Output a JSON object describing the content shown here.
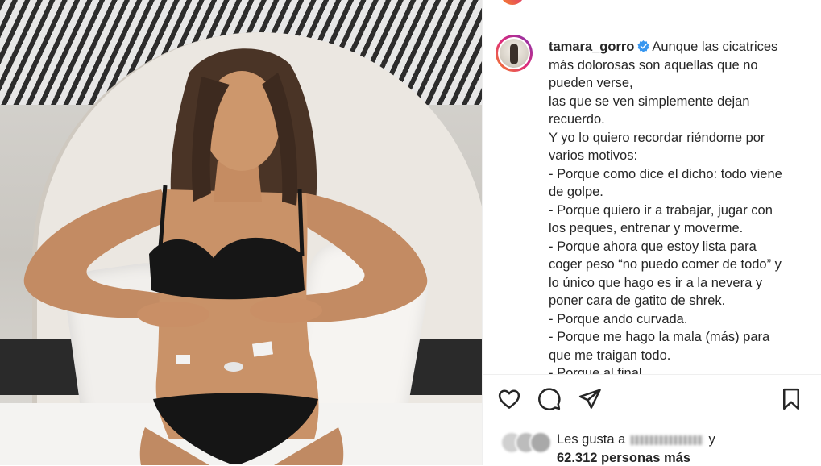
{
  "post": {
    "username": "tamara_gorro",
    "verified": true,
    "caption_lines": [
      "Aunque las cicatrices",
      "más dolorosas son aquellas que no",
      "pueden verse,",
      "las que se ven simplemente dejan",
      "recuerdo.",
      "Y yo lo quiero recordar riéndome por",
      "varios motivos:",
      "- Porque como dice el dicho: todo viene",
      "de golpe.",
      "- Porque quiero ir a trabajar, jugar con",
      "los peques, entrenar y moverme.",
      "- Porque ahora que estoy lista para",
      "coger peso “no puedo comer de todo” y",
      "lo único que hago es ir a la nevera y",
      "poner cara de gatito de shrek.",
      "- Porque ando curvada.",
      "- Porque me hago la mala (más) para",
      "que me traigan todo.",
      "- Porque al final..."
    ]
  },
  "actions": {
    "like": "heart-icon",
    "comment": "comment-icon",
    "share": "share-icon",
    "save": "bookmark-icon"
  },
  "likes": {
    "prefix": "Les gusta a",
    "suffix": "y",
    "count_text": "62.312 personas más"
  },
  "colors": {
    "text": "#262626",
    "verified": "#3897f0",
    "ring_start": "#f58529",
    "ring_end": "#8134af",
    "border": "#efefef"
  }
}
